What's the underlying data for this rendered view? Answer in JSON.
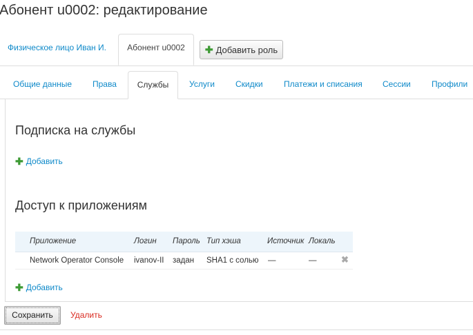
{
  "page": {
    "title": "Абонент u0002: редактирование"
  },
  "role_tabs": {
    "person_tab": "Физическое лицо Иван И.",
    "subscriber_tab": "Абонент u0002",
    "add_role_label": "Добавить роль"
  },
  "sub_tabs": [
    "Общие данные",
    "Права",
    "Службы",
    "Услуги",
    "Скидки",
    "Платежи и списания",
    "Сессии",
    "Профили"
  ],
  "services_section": {
    "title": "Подписка на службы",
    "add_label": "Добавить"
  },
  "apps_section": {
    "title": "Доступ к приложениям",
    "columns": [
      "Приложение",
      "Логин",
      "Пароль",
      "Тип хэша",
      "Источник",
      "Локаль"
    ],
    "rows": [
      [
        "Network Operator Console",
        "ivanov-II",
        "задан",
        "SHA1 с солью",
        "—",
        "—"
      ]
    ],
    "add_label": "Добавить"
  },
  "footer": {
    "save_label": "Сохранить",
    "delete_label": "Удалить"
  },
  "colors": {
    "link": "#0e89c9",
    "add_icon": "#3d9a34",
    "danger": "#d9291f"
  }
}
